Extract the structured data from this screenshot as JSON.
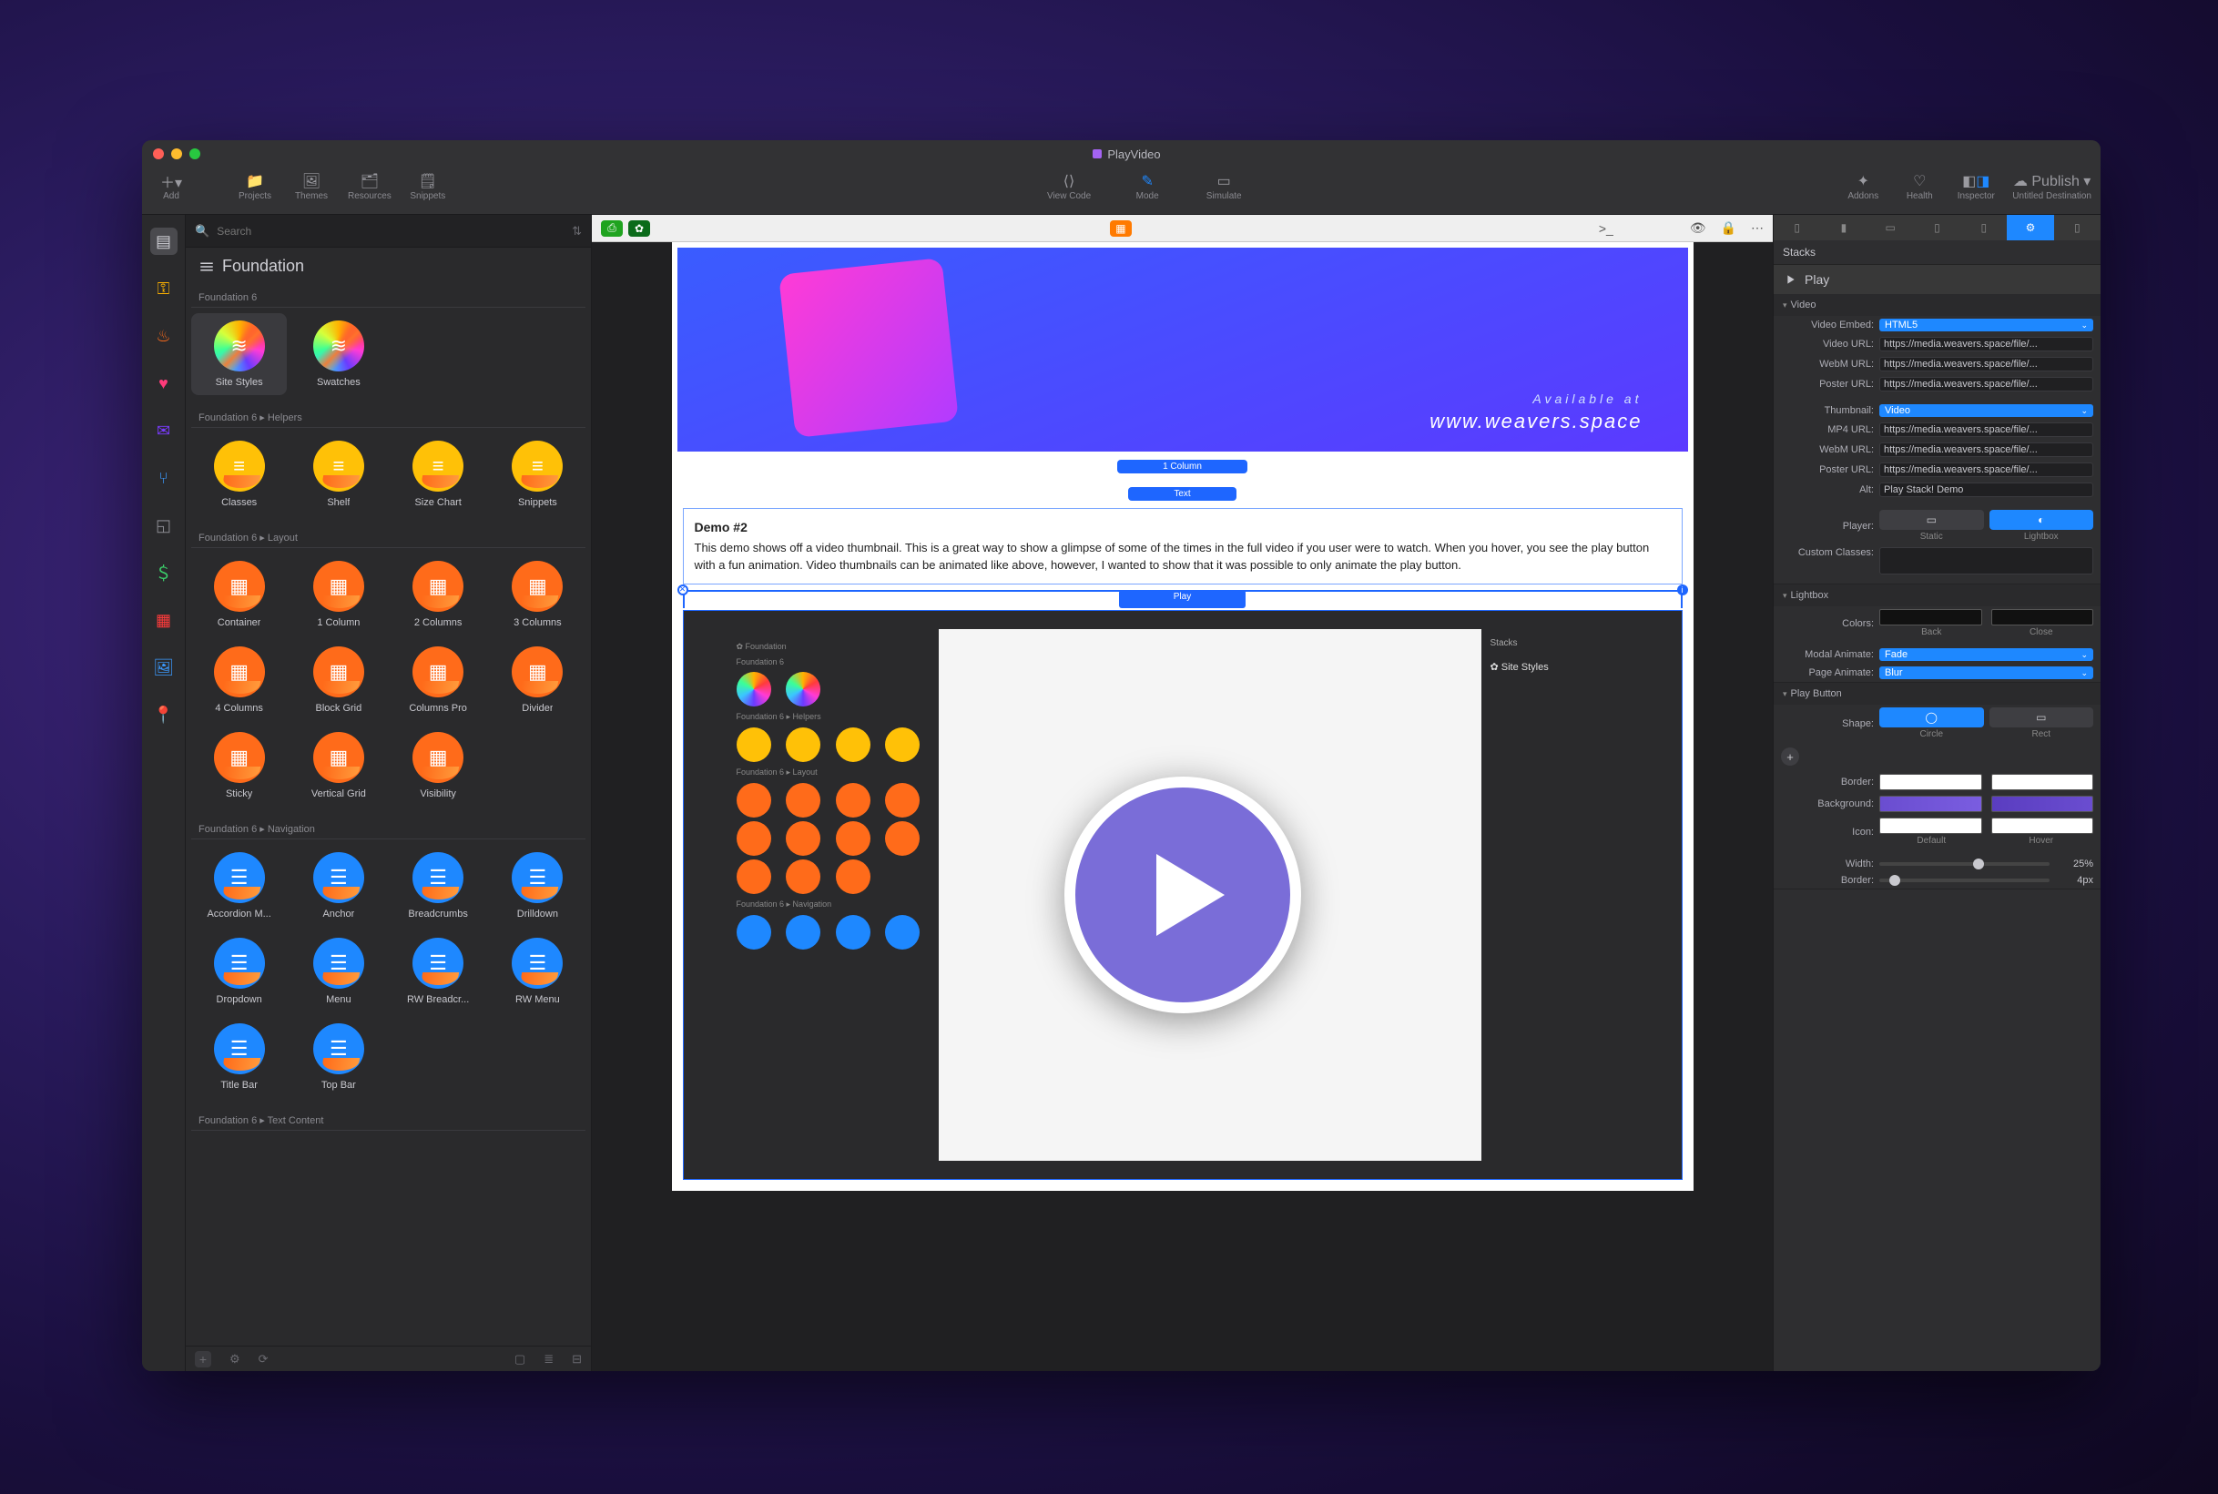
{
  "window_title": "PlayVideo",
  "toolbar": {
    "left": [
      {
        "icon": "plus",
        "label": "Add"
      },
      {
        "icon": "folder",
        "label": "Projects"
      },
      {
        "icon": "image",
        "label": "Themes"
      },
      {
        "icon": "box",
        "label": "Resources"
      },
      {
        "icon": "snippet",
        "label": "Snippets"
      }
    ],
    "center": [
      {
        "icon": "code",
        "label": "View Code"
      },
      {
        "icon": "pencil",
        "label": "Mode"
      },
      {
        "icon": "window",
        "label": "Simulate"
      }
    ],
    "right": [
      {
        "icon": "puzzle",
        "label": "Addons"
      },
      {
        "icon": "heart",
        "label": "Health"
      },
      {
        "icon": "panel",
        "label": "Inspector"
      },
      {
        "icon": "cloud",
        "label": "Publish"
      },
      {
        "icon": "dest",
        "label": "Untitled Destination"
      }
    ]
  },
  "search_placeholder": "Search",
  "library": {
    "title": "Foundation",
    "sub1": "Foundation 6",
    "group1": [
      {
        "label": "Site Styles",
        "style": "rainbow"
      },
      {
        "label": "Swatches",
        "style": "rainbow"
      }
    ],
    "sub2": "Foundation 6 ▸ Helpers",
    "group2": [
      {
        "label": "Classes",
        "style": "yellow"
      },
      {
        "label": "Shelf",
        "style": "yellow"
      },
      {
        "label": "Size Chart",
        "style": "yellow"
      },
      {
        "label": "Snippets",
        "style": "yellow"
      }
    ],
    "sub3": "Foundation 6 ▸ Layout",
    "group3": [
      {
        "label": "Container",
        "style": "orange"
      },
      {
        "label": "1 Column",
        "style": "orange"
      },
      {
        "label": "2 Columns",
        "style": "orange"
      },
      {
        "label": "3 Columns",
        "style": "orange"
      },
      {
        "label": "4 Columns",
        "style": "orange"
      },
      {
        "label": "Block Grid",
        "style": "orange"
      },
      {
        "label": "Columns Pro",
        "style": "orange"
      },
      {
        "label": "Divider",
        "style": "orange"
      },
      {
        "label": "Sticky",
        "style": "orange"
      },
      {
        "label": "Vertical Grid",
        "style": "orange"
      },
      {
        "label": "Visibility",
        "style": "orange"
      }
    ],
    "sub4": "Foundation 6 ▸ Navigation",
    "group4": [
      {
        "label": "Accordion M...",
        "style": "blue"
      },
      {
        "label": "Anchor",
        "style": "blue"
      },
      {
        "label": "Breadcrumbs",
        "style": "blue"
      },
      {
        "label": "Drilldown",
        "style": "blue"
      },
      {
        "label": "Dropdown",
        "style": "blue"
      },
      {
        "label": "Menu",
        "style": "blue"
      },
      {
        "label": "RW Breadcr...",
        "style": "blue"
      },
      {
        "label": "RW Menu",
        "style": "blue"
      },
      {
        "label": "Title Bar",
        "style": "blue"
      },
      {
        "label": "Top Bar",
        "style": "blue"
      }
    ],
    "sub5": "Foundation 6 ▸ Text Content"
  },
  "canvas": {
    "pill_1col": "1 Column",
    "pill_text": "Text",
    "pill_play": "Play",
    "hero_sub1": "Available at",
    "hero_sub2": "www.weavers.space",
    "demo_title": "Demo #2",
    "demo_body": "This demo shows off a video thumbnail. This is a great way to show a glimpse of some of the times in the full video if you user were to watch. When you hover, you see the play button with a fun animation. Video thumbnails can be animated like above, however, I wanted to show that it was possible to only animate the play button."
  },
  "inspector": {
    "stacks_label": "Stacks",
    "head": "Play",
    "video": {
      "title": "Video",
      "embed_label": "Video Embed:",
      "embed_value": "HTML5",
      "video_url_label": "Video URL:",
      "video_url": "https://media.weavers.space/file/...",
      "webm_url_label": "WebM URL:",
      "webm_url": "https://media.weavers.space/file/...",
      "poster_url_label": "Poster URL:",
      "poster_url": "https://media.weavers.space/file/...",
      "thumb_label": "Thumbnail:",
      "thumb_value": "Video",
      "mp4_label": "MP4 URL:",
      "mp4_url": "https://media.weavers.space/file/...",
      "webm2_label": "WebM URL:",
      "webm2_url": "https://media.weavers.space/file/...",
      "poster2_label": "Poster URL:",
      "poster2_url": "https://media.weavers.space/file/...",
      "alt_label": "Alt:",
      "alt_value": "Play Stack! Demo",
      "player_label": "Player:",
      "player_static": "Static",
      "player_lightbox": "Lightbox",
      "custom_classes_label": "Custom Classes:"
    },
    "lightbox": {
      "title": "Lightbox",
      "colors_label": "Colors:",
      "back": "Back",
      "close": "Close",
      "modal_label": "Modal Animate:",
      "modal_value": "Fade",
      "page_label": "Page Animate:",
      "page_value": "Blur"
    },
    "playbtn": {
      "title": "Play Button",
      "shape_label": "Shape:",
      "circle": "Circle",
      "rect": "Rect",
      "border_label": "Border:",
      "bg_label": "Background:",
      "icon_label": "Icon:",
      "default": "Default",
      "hover": "Hover",
      "width_label": "Width:",
      "width_value": "25%",
      "border2_label": "Border:",
      "border2_value": "4px"
    }
  }
}
